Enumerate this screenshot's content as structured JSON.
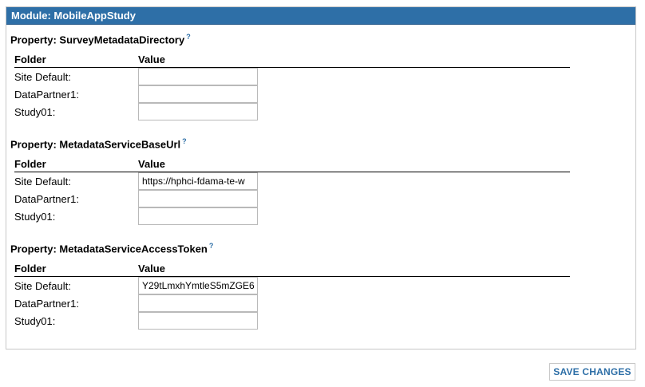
{
  "module": {
    "title": "Module: MobileAppStudy"
  },
  "table_headers": {
    "folder": "Folder",
    "value": "Value"
  },
  "help_glyph": "?",
  "properties": [
    {
      "title": "Property: SurveyMetadataDirectory",
      "rows": [
        {
          "folder": "Site Default:",
          "value": ""
        },
        {
          "folder": "DataPartner1:",
          "value": ""
        },
        {
          "folder": "Study01:",
          "value": ""
        }
      ]
    },
    {
      "title": "Property: MetadataServiceBaseUrl",
      "rows": [
        {
          "folder": "Site Default:",
          "value": "https://hphci-fdama-te-w"
        },
        {
          "folder": "DataPartner1:",
          "value": ""
        },
        {
          "folder": "Study01:",
          "value": ""
        }
      ]
    },
    {
      "title": "Property: MetadataServiceAccessToken",
      "rows": [
        {
          "folder": "Site Default:",
          "value": "Y29tLmxhYmtleS5mZGE6"
        },
        {
          "folder": "DataPartner1:",
          "value": ""
        },
        {
          "folder": "Study01:",
          "value": ""
        }
      ]
    }
  ],
  "actions": {
    "save_label": "SAVE CHANGES"
  },
  "colors": {
    "header_bg": "#2e6fa7",
    "accent": "#2e6fa7",
    "border": "#c8c8c8"
  }
}
